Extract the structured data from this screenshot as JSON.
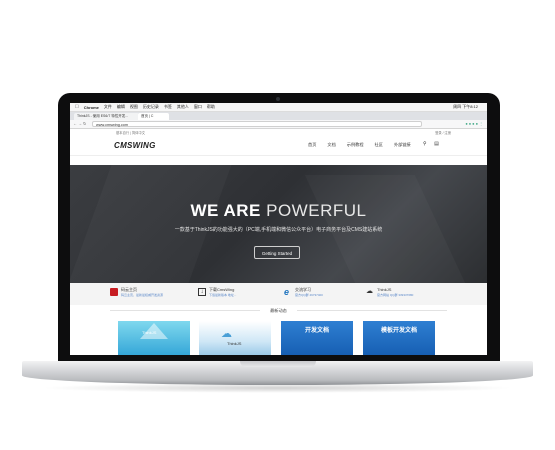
{
  "menubar": {
    "app": "Chrome",
    "items": [
      "文件",
      "编辑",
      "视图",
      "历史记录",
      "书签",
      "其他人",
      "窗口",
      "帮助"
    ],
    "clock": "周四 下午8:12"
  },
  "browser": {
    "tabs": [
      "ThinkJS - 使用 ES6/7 特性开发...",
      "首页 | C"
    ],
    "url": "www.cmswing.com"
  },
  "site": {
    "topbar_left": "基本自行 | 简体中文",
    "topbar_right": "登录 / 注册",
    "logo": "CMSWING",
    "nav": [
      "首页",
      "文档",
      "示例教程",
      "社区",
      "外部链接"
    ],
    "hero": {
      "headline_bold": "WE ARE",
      "headline_light": "POWERFUL",
      "subtitle": "一款基于ThinkJS的功能强大的（PC端,手机端和微信公众平台）电子商务平台及CMS建站系统",
      "cta": "Getting Started"
    },
    "features": [
      {
        "title": "码云主页",
        "sub": "码云主页，最新最权威开发资源",
        "icon": "gitee-icon"
      },
      {
        "title": "下载CmsWing",
        "sub": "下载最新版本 地址...",
        "icon": "download-icon"
      },
      {
        "title": "交流学习",
        "sub": "官方QQ群 49737400",
        "icon": "chat-icon"
      },
      {
        "title": "ThinkJS",
        "sub": "官方网站 QQ群 339337680",
        "icon": "thinkjs-icon"
      }
    ],
    "section_title": "最新动态",
    "cards": [
      {
        "caption": "",
        "label": "ThinkJS"
      },
      {
        "caption": "",
        "label": "ThinkJS"
      },
      {
        "caption": "开发文档",
        "label": ""
      },
      {
        "caption": "模板开发文档",
        "label": ""
      }
    ]
  },
  "colors": {
    "hero": "#36383c",
    "accent_blue": "#1e6fc8",
    "link_blue": "#5b88c9"
  }
}
